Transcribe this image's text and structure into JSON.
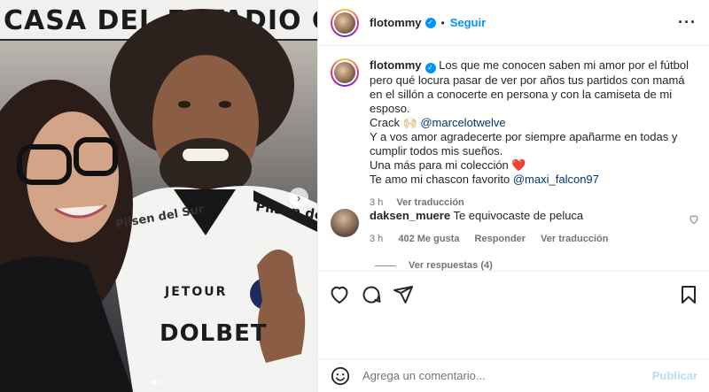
{
  "photo": {
    "banner_text": "CASA DEL ESTADIO CAMP",
    "jersey": {
      "sponsor_chest": "Pilsen del Sur",
      "sponsor_sleeve": "Pilsen del Sur",
      "sponsor_mid": "JETOUR",
      "sponsor_main": "DOLBET"
    },
    "carousel": {
      "next_icon": "chevron-right-icon",
      "slide_count": 2,
      "active_index": 0
    }
  },
  "header": {
    "username": "flotommy",
    "verified_icon": "verified-badge-icon",
    "separator": "•",
    "follow_label": "Seguir",
    "more_icon": "more-options-icon"
  },
  "caption": {
    "username": "flotommy",
    "line1": "Los que me conocen saben mi amor por el fútbol pero qué locura pasar de ver por años tus partidos con mamá en el sillón a conocerte en persona y con la camiseta de mi esposo.",
    "line2_prefix": "Crack 🙌🏻 ",
    "mention1": "@marcelotwelve",
    "line3": "Y a vos amor agradecerte por siempre apañarme en todas y cumplir todos mis sueños.",
    "line4": "Una más para mi colección ",
    "heart": "❤️",
    "line5_prefix": "Te amo mi chascon favorito ",
    "mention2": "@maxi_falcon97",
    "time": "3 h",
    "translate": "Ver traducción"
  },
  "comment": {
    "username": "daksen_muere",
    "text": "Te equivocaste de peluca",
    "time": "3 h",
    "likes": "402 Me gusta",
    "reply": "Responder",
    "translate": "Ver traducción",
    "view_replies": "Ver respuestas (4)"
  },
  "actions": {
    "like_icon": "heart-icon",
    "comment_icon": "comment-icon",
    "share_icon": "share-icon",
    "save_icon": "bookmark-icon"
  },
  "add_comment": {
    "emoji_icon": "emoji-icon",
    "placeholder": "Agrega un comentario...",
    "publish_label": "Publicar"
  },
  "colors": {
    "accent": "#0095f6",
    "mention": "#00376b",
    "muted": "#737373",
    "publish_disabled": "#b2dffc"
  }
}
